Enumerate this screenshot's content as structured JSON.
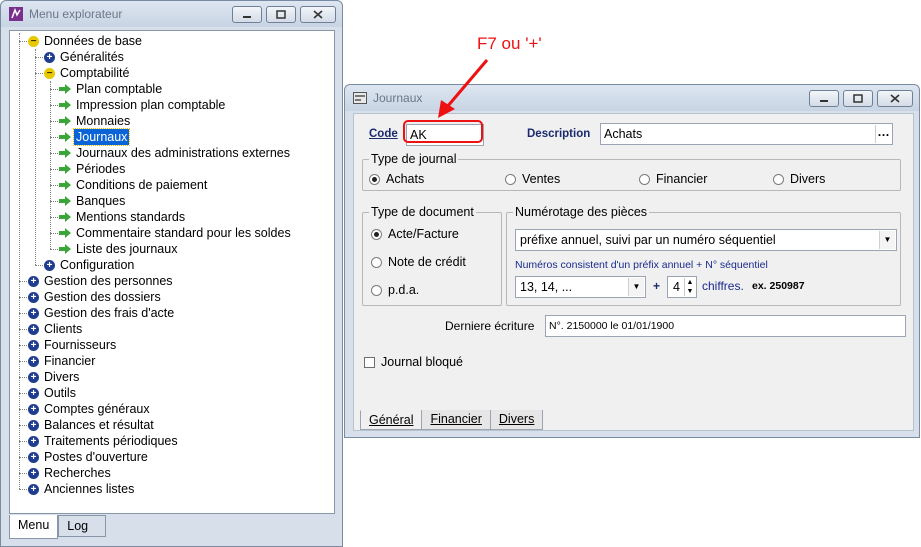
{
  "explorer": {
    "title": "Menu explorateur",
    "tree": [
      {
        "label": "Données de base",
        "icon": "minus",
        "depth": 0
      },
      {
        "label": "Généralités",
        "icon": "plus",
        "depth": 1
      },
      {
        "label": "Comptabilité",
        "icon": "minus",
        "depth": 1
      },
      {
        "label": "Plan comptable",
        "icon": "arrow",
        "depth": 2
      },
      {
        "label": "Impression plan comptable",
        "icon": "arrow",
        "depth": 2
      },
      {
        "label": "Monnaies",
        "icon": "arrow",
        "depth": 2
      },
      {
        "label": "Journaux",
        "icon": "arrow",
        "depth": 2,
        "selected": true
      },
      {
        "label": "Journaux des administrations externes",
        "icon": "arrow",
        "depth": 2
      },
      {
        "label": "Périodes",
        "icon": "arrow",
        "depth": 2
      },
      {
        "label": "Conditions de paiement",
        "icon": "arrow",
        "depth": 2
      },
      {
        "label": "Banques",
        "icon": "arrow",
        "depth": 2
      },
      {
        "label": "Mentions standards",
        "icon": "arrow",
        "depth": 2
      },
      {
        "label": "Commentaire standard pour les soldes",
        "icon": "arrow",
        "depth": 2
      },
      {
        "label": "Liste des journaux",
        "icon": "arrow",
        "depth": 2
      },
      {
        "label": "Configuration",
        "icon": "plus",
        "depth": 1
      },
      {
        "label": "Gestion des personnes",
        "icon": "plus",
        "depth": 0
      },
      {
        "label": "Gestion des dossiers",
        "icon": "plus",
        "depth": 0
      },
      {
        "label": "Gestion des frais d'acte",
        "icon": "plus",
        "depth": 0
      },
      {
        "label": "Clients",
        "icon": "plus",
        "depth": 0
      },
      {
        "label": "Fournisseurs",
        "icon": "plus",
        "depth": 0
      },
      {
        "label": "Financier",
        "icon": "plus",
        "depth": 0
      },
      {
        "label": "Divers",
        "icon": "plus",
        "depth": 0
      },
      {
        "label": "Outils",
        "icon": "plus",
        "depth": 0
      },
      {
        "label": "Comptes généraux",
        "icon": "plus",
        "depth": 0
      },
      {
        "label": "Balances et résultat",
        "icon": "plus",
        "depth": 0
      },
      {
        "label": "Traitements périodiques",
        "icon": "plus",
        "depth": 0
      },
      {
        "label": "Postes d'ouverture",
        "icon": "plus",
        "depth": 0
      },
      {
        "label": "Recherches",
        "icon": "plus",
        "depth": 0
      },
      {
        "label": "Anciennes listes",
        "icon": "plus",
        "depth": 0
      }
    ],
    "tabs": [
      "Menu",
      "Log"
    ]
  },
  "dialog": {
    "title": "Journaux",
    "code_label": "Code",
    "code_value": "AK",
    "description_label": "Description",
    "description_value": "Achats",
    "type_journal": {
      "title": "Type de journal",
      "options": [
        "Achats",
        "Ventes",
        "Financier",
        "Divers"
      ],
      "selected": "Achats"
    },
    "type_document": {
      "title": "Type de document",
      "options": [
        "Acte/Facture",
        "Note de crédit",
        "p.d.a."
      ],
      "selected": "Acte/Facture"
    },
    "numerotage": {
      "title": "Numérotage des pièces",
      "mode_value": "préfixe annuel, suivi par un numéro séquentiel",
      "info_text": "Numéros consistent d'un préfix annuel + N° séquentiel",
      "prefix_value": "13, 14, ...",
      "plus_sign": "+",
      "digits_value": "4",
      "digits_label": "chiffres.",
      "example": "ex. 250987"
    },
    "derniere_label": "Derniere écriture",
    "derniere_value": "N°. 2150000 le 01/01/1900",
    "journal_bloque_label": "Journal bloqué",
    "tabs": [
      "Général",
      "Financier",
      "Divers"
    ]
  },
  "annotation": {
    "text": "F7 ou '+'",
    "color": "#ee1111"
  }
}
